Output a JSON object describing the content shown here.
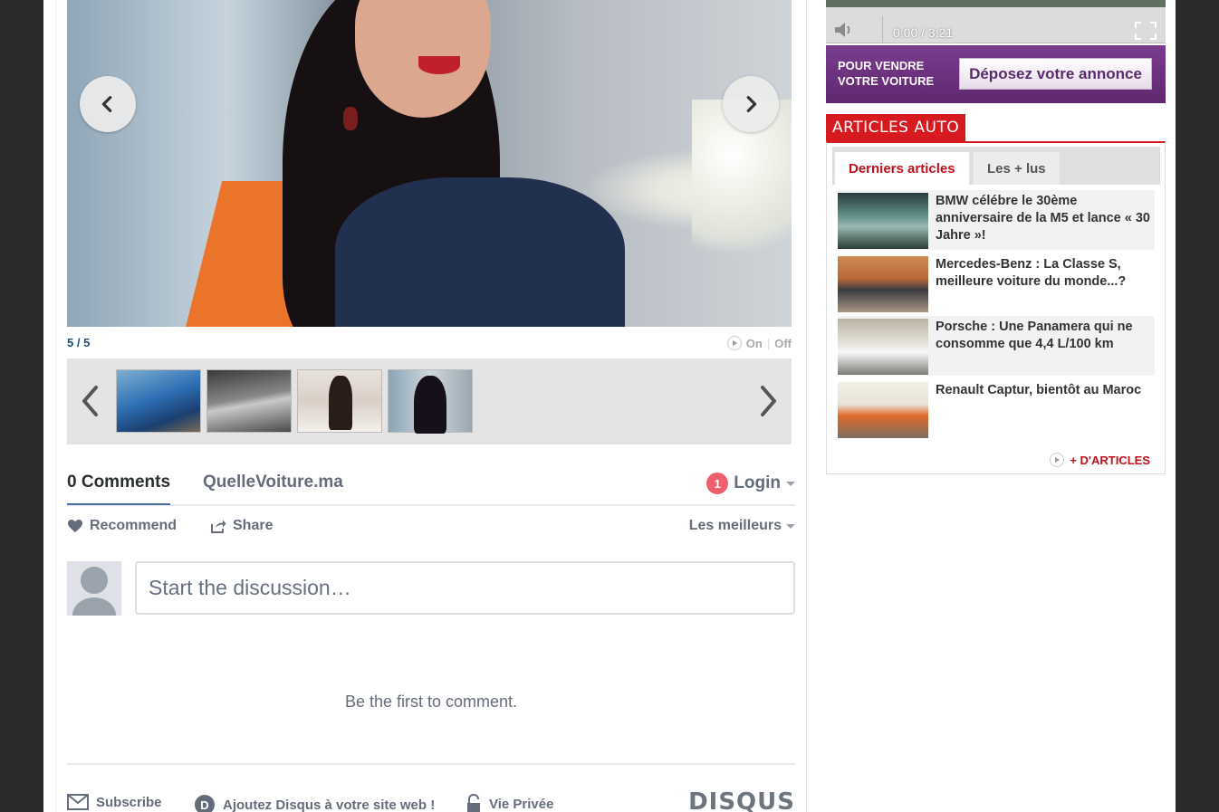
{
  "gallery": {
    "counter": "5 / 5",
    "autoplay_on": "On",
    "autoplay_off": "Off"
  },
  "comments": {
    "count_label": "0 Comments",
    "site_name": "QuelleVoiture.ma",
    "notification_count": "1",
    "login_label": "Login",
    "recommend_label": "Recommend",
    "share_label": "Share",
    "sort_label": "Les meilleurs",
    "input_placeholder": "Start the discussion…",
    "empty_message": "Be the first to comment.",
    "footer": {
      "subscribe": "Subscribe",
      "add_disqus": "Ajoutez Disqus à votre site web !",
      "privacy": "Vie Privée",
      "brand": "DISQUS"
    }
  },
  "video": {
    "time": "0:00 / 3:21"
  },
  "sell_banner": {
    "line1": "POUR VENDRE",
    "line2": "VOTRE VOITURE",
    "button": "Déposez votre annonce"
  },
  "articles": {
    "heading": "ARTICLES AUTO",
    "tabs": [
      "Derniers articles",
      "Les + lus"
    ],
    "items": [
      {
        "title": "BMW célébre le 30ème anniversaire de la M5 et lance « 30 Jahre »!"
      },
      {
        "title": "Mercedes-Benz : La Classe S, meilleure voiture du monde...?"
      },
      {
        "title": "Porsche : Une Panamera qui ne consomme que 4,4 L/100 km"
      },
      {
        "title": "Renault Captur, bientôt au Maroc"
      }
    ],
    "more_label": "+ D'ARTICLES"
  },
  "colors": {
    "accent_red": "#d71920",
    "disqus_blue": "#4a6ea0",
    "sell_purple": "#6b3280"
  }
}
